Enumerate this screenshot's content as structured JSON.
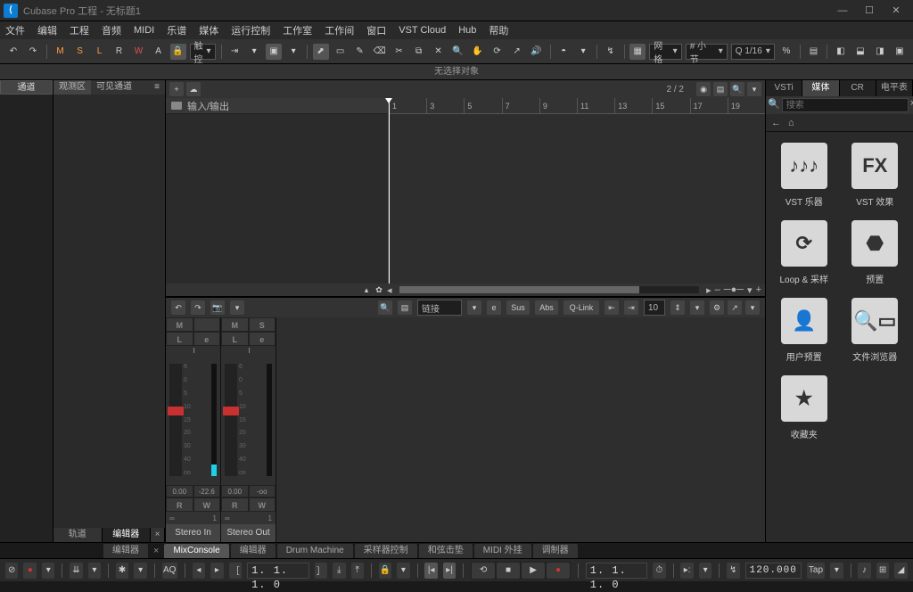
{
  "title": "Cubase Pro 工程 - 无标题1",
  "menu": [
    "文件",
    "编辑",
    "工程",
    "音频",
    "MIDI",
    "乐谱",
    "媒体",
    "运行控制",
    "工作室",
    "工作间",
    "窗口",
    "VST Cloud",
    "Hub",
    "帮助"
  ],
  "toolbar": {
    "state": [
      "M",
      "S",
      "L",
      "R",
      "W",
      "A"
    ],
    "automation_mode": "触控",
    "grid_label": "网格",
    "bars_label": "# 小节",
    "quantize": "Q  1/16"
  },
  "status": "无选择对象",
  "left": {
    "tab": "通道",
    "bottom": {
      "tracks": "轨道",
      "editor": "编辑器"
    }
  },
  "inspector": {
    "tabs": {
      "overview": "观测区",
      "visible": "可见通道"
    },
    "eq": "≡"
  },
  "tracks": {
    "count": "2 / 2",
    "folder": "输入/输出",
    "ruler": [
      "1",
      "3",
      "5",
      "7",
      "9",
      "11",
      "13",
      "15",
      "17",
      "19"
    ]
  },
  "mixer": {
    "link": "链接",
    "sus": "Sus",
    "abs": "Abs",
    "qlink": "Q-Link",
    "width": "10",
    "channels": [
      {
        "name": "Stereo In",
        "m": "M",
        "s": "",
        "l": "L",
        "e": "e",
        "val1": "0.00",
        "val2": "-22.6",
        "r": "R",
        "w": "W",
        "num": "1",
        "meter": 10,
        "fader": 38
      },
      {
        "name": "Stereo Out",
        "m": "M",
        "s": "S",
        "l": "L",
        "e": "e",
        "val1": "0.00",
        "val2": "-oo",
        "r": "R",
        "w": "W",
        "num": "1",
        "meter": 0,
        "fader": 38
      }
    ],
    "scale": [
      "6",
      "0",
      "5",
      "10",
      "15",
      "20",
      "30",
      "40",
      "oo"
    ]
  },
  "right": {
    "tabs": [
      "VSTi",
      "媒体",
      "CR",
      "电平表"
    ],
    "search_placeholder": "搜索",
    "items": [
      {
        "icon": "piano",
        "label": "VST 乐器"
      },
      {
        "icon": "fx",
        "label": "VST 效果"
      },
      {
        "icon": "loop",
        "label": "Loop & 采样"
      },
      {
        "icon": "preset",
        "label": "预置"
      },
      {
        "icon": "user",
        "label": "用户预置"
      },
      {
        "icon": "browser",
        "label": "文件浏览器"
      },
      {
        "icon": "star",
        "label": "收藏夹"
      }
    ]
  },
  "bottom_tabs": [
    "MixConsole",
    "编辑器",
    "Drum Machine",
    "采样器控制",
    "和弦击垫",
    "MIDI 外挂",
    "调制器"
  ],
  "bottom_first": "编辑器",
  "transport": {
    "aq": "AQ",
    "time1": "1. 1. 1.  0",
    "time2": "1. 1. 1.  0",
    "tempo": "120.000",
    "tap": "Tap",
    "click": true
  }
}
